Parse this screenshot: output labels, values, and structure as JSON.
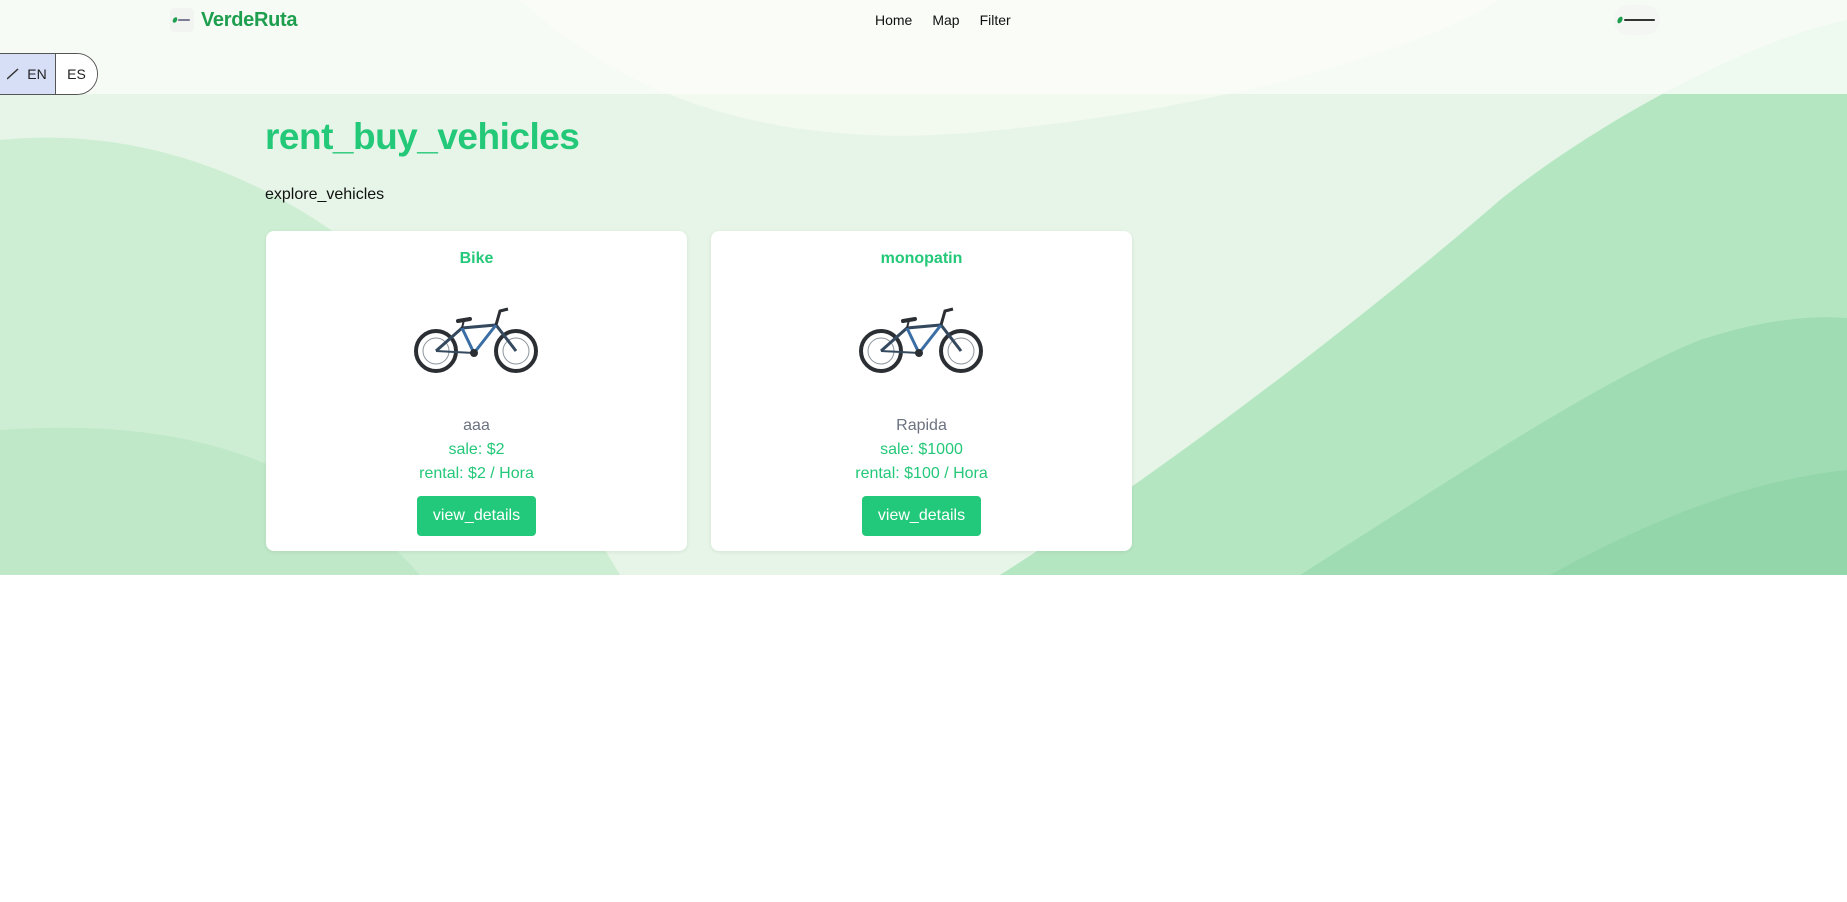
{
  "header": {
    "brand": "VerdeRuta",
    "brand_logo_text": "VerdeRuta",
    "avatar_text": "VerdeRuta",
    "nav": [
      "Home",
      "Map",
      "Filter"
    ]
  },
  "language": {
    "en": "EN",
    "es": "ES",
    "selected": "EN"
  },
  "main": {
    "title": "rent_buy_vehicles",
    "subtitle": "explore_vehicles"
  },
  "vehicles": [
    {
      "name": "Bike",
      "image_icon": "bicycle-image",
      "description": "aaa",
      "sale": "sale: $2",
      "rental": "rental: $2 / Hora",
      "button": "view_details"
    },
    {
      "name": "monopatin",
      "image_icon": "bicycle-image",
      "description": "Rapida",
      "sale": "sale: $1000",
      "rental": "rental: $100 / Hora",
      "button": "view_details"
    }
  ],
  "colors": {
    "brand": "#1e9e4f",
    "accent": "#23c878",
    "button": "#22c97a",
    "lang_selected_bg": "#d6dff5"
  }
}
